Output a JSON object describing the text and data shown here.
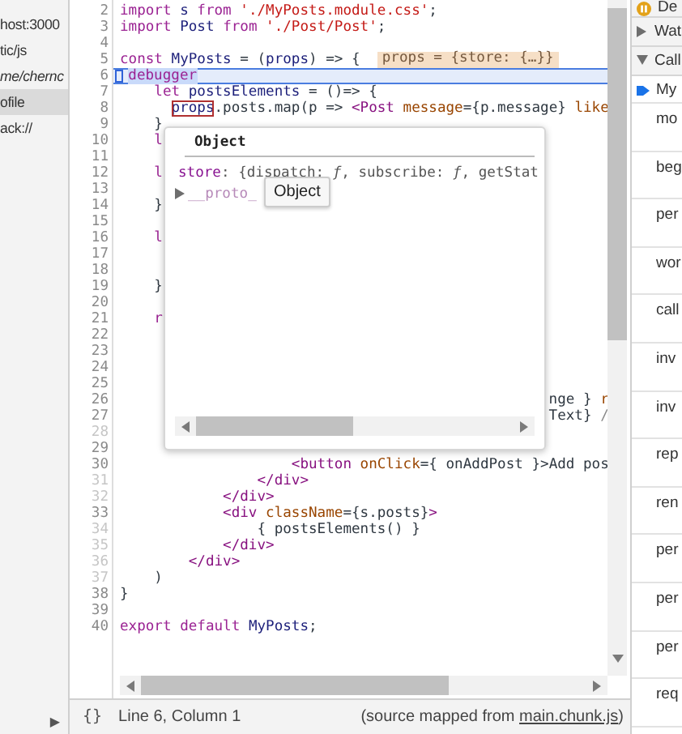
{
  "sidebar": {
    "items": [
      {
        "label": "host:3000",
        "selected": false,
        "italic": false
      },
      {
        "label": "tic/js",
        "selected": false,
        "italic": false
      },
      {
        "label": "me/chernc",
        "selected": false,
        "italic": true
      },
      {
        "label": "ofile",
        "selected": true,
        "italic": false
      },
      {
        "label": "ack://",
        "selected": false,
        "italic": false
      }
    ],
    "toggle": "▶"
  },
  "editor": {
    "lines": [
      {
        "number": "2",
        "breakable": true,
        "current": false,
        "tokens": [
          {
            "kind": "kw",
            "text": "import"
          },
          {
            "kind": "def",
            "text": " s "
          },
          {
            "kind": "kw",
            "text": "from"
          },
          {
            "kind": "str",
            "text": " './MyPosts.module.css'"
          },
          {
            "kind": "plain",
            "text": ";"
          }
        ]
      },
      {
        "number": "3",
        "breakable": true,
        "current": false,
        "tokens": [
          {
            "kind": "kw",
            "text": "import"
          },
          {
            "kind": "def",
            "text": " Post "
          },
          {
            "kind": "kw",
            "text": "from"
          },
          {
            "kind": "str",
            "text": " './Post/Post'"
          },
          {
            "kind": "plain",
            "text": ";"
          }
        ]
      },
      {
        "number": "4",
        "breakable": true,
        "current": false
      },
      {
        "number": "5",
        "breakable": true,
        "current": false,
        "tokens": [
          {
            "kind": "kw",
            "text": "const"
          },
          {
            "kind": "def",
            "text": " MyPosts"
          },
          {
            "kind": "plain",
            "text": " = ("
          },
          {
            "kind": "def",
            "text": "props"
          },
          {
            "kind": "plain",
            "text": ") => {"
          }
        ],
        "inline_value": "props = {store: {…}}"
      },
      {
        "number": "6",
        "breakable": true,
        "current": true,
        "tokens": [
          {
            "kind": "kw",
            "text": "  debugger"
          }
        ]
      },
      {
        "number": "7",
        "breakable": true,
        "current": false,
        "tokens": [
          {
            "kind": "kw",
            "text": "    let"
          },
          {
            "kind": "def",
            "text": " postsElements"
          },
          {
            "kind": "plain",
            "text": " = ()=> {"
          }
        ]
      },
      {
        "number": "8",
        "breakable": true,
        "current": false,
        "tokens": [
          {
            "kind": "hover",
            "text": "      props"
          },
          {
            "kind": "plain",
            "text": ".posts.map(p => "
          },
          {
            "kind": "tag",
            "text": "<Post"
          },
          {
            "kind": "attr",
            "text": " message"
          },
          {
            "kind": "plain",
            "text": "={p.message} "
          },
          {
            "kind": "attr",
            "text": "like"
          }
        ]
      },
      {
        "number": "9",
        "breakable": true,
        "current": false,
        "tokens": [
          {
            "kind": "plain",
            "text": "    }"
          }
        ]
      },
      {
        "number": "10",
        "breakable": true,
        "current": false,
        "tokens": [
          {
            "kind": "kw",
            "text": "    l"
          }
        ]
      },
      {
        "number": "11",
        "breakable": true,
        "current": false
      },
      {
        "number": "12",
        "breakable": true,
        "current": false,
        "tokens": [
          {
            "kind": "kw",
            "text": "    l"
          }
        ]
      },
      {
        "number": "13",
        "breakable": true,
        "current": false
      },
      {
        "number": "14",
        "breakable": true,
        "current": false,
        "tokens": [
          {
            "kind": "plain",
            "text": "    }"
          }
        ]
      },
      {
        "number": "15",
        "breakable": true,
        "current": false
      },
      {
        "number": "16",
        "breakable": true,
        "current": false,
        "tokens": [
          {
            "kind": "kw",
            "text": "    l"
          }
        ]
      },
      {
        "number": "17",
        "breakable": true,
        "current": false
      },
      {
        "number": "18",
        "breakable": true,
        "current": false
      },
      {
        "number": "19",
        "breakable": true,
        "current": false,
        "tokens": [
          {
            "kind": "plain",
            "text": "    }"
          }
        ]
      },
      {
        "number": "20",
        "breakable": true,
        "current": false
      },
      {
        "number": "21",
        "breakable": true,
        "current": false,
        "tokens": [
          {
            "kind": "kw",
            "text": "    r"
          }
        ]
      },
      {
        "number": "22",
        "breakable": true,
        "current": false
      },
      {
        "number": "23",
        "breakable": true,
        "current": false
      },
      {
        "number": "24",
        "breakable": true,
        "current": false
      },
      {
        "number": "25",
        "breakable": true,
        "current": false
      },
      {
        "number": "26",
        "breakable": true,
        "current": false,
        "tokens": [
          {
            "kind": "plain",
            "text": "                                                  nge } "
          },
          {
            "kind": "attr",
            "text": "r"
          }
        ]
      },
      {
        "number": "27",
        "breakable": true,
        "current": false,
        "tokens": [
          {
            "kind": "plain",
            "text": "                                                  Text} "
          },
          {
            "kind": "comment",
            "text": "/"
          }
        ]
      },
      {
        "number": "28",
        "breakable": false,
        "current": false
      },
      {
        "number": "29",
        "breakable": true,
        "current": false
      },
      {
        "number": "30",
        "breakable": true,
        "current": false,
        "tokens": [
          {
            "kind": "tag",
            "text": "                    <button"
          },
          {
            "kind": "attr",
            "text": " onClick"
          },
          {
            "kind": "plain",
            "text": "={ onAddPost }>Add pos"
          }
        ]
      },
      {
        "number": "31",
        "breakable": false,
        "current": false,
        "tokens": [
          {
            "kind": "tag",
            "text": "                </div>"
          }
        ]
      },
      {
        "number": "32",
        "breakable": false,
        "current": false,
        "tokens": [
          {
            "kind": "tag",
            "text": "            </div>"
          }
        ]
      },
      {
        "number": "33",
        "breakable": true,
        "current": false,
        "tokens": [
          {
            "kind": "tag",
            "text": "            <div"
          },
          {
            "kind": "attr",
            "text": " className"
          },
          {
            "kind": "plain",
            "text": "={s.posts}"
          },
          {
            "kind": "tag",
            "text": ">"
          }
        ]
      },
      {
        "number": "34",
        "breakable": false,
        "current": false,
        "tokens": [
          {
            "kind": "plain",
            "text": "                { postsElements() }"
          }
        ]
      },
      {
        "number": "35",
        "breakable": false,
        "current": false,
        "tokens": [
          {
            "kind": "tag",
            "text": "            </div>"
          }
        ]
      },
      {
        "number": "36",
        "breakable": false,
        "current": false,
        "tokens": [
          {
            "kind": "tag",
            "text": "        </div>"
          }
        ]
      },
      {
        "number": "37",
        "breakable": false,
        "current": false,
        "tokens": [
          {
            "kind": "plain",
            "text": "    )"
          }
        ]
      },
      {
        "number": "38",
        "breakable": true,
        "current": false,
        "tokens": [
          {
            "kind": "plain",
            "text": "}"
          }
        ]
      },
      {
        "number": "39",
        "breakable": true,
        "current": false
      },
      {
        "number": "40",
        "breakable": true,
        "current": false,
        "tokens": [
          {
            "kind": "kw",
            "text": "export"
          },
          {
            "kind": "kw",
            "text": " default"
          },
          {
            "kind": "def",
            "text": " MyPosts"
          },
          {
            "kind": "plain",
            "text": ";"
          }
        ]
      }
    ],
    "popover": {
      "title": "Object",
      "properties": [
        {
          "key": "store",
          "value": ": {dispatch: *ƒ*, subscribe: *ƒ*, getStat",
          "kind": "own"
        },
        {
          "key": "__proto_",
          "kind": "proto"
        }
      ],
      "tooltip": "Object"
    }
  },
  "status_bar": {
    "format_button": "{}",
    "position": "Line 6, Column 1",
    "source_prefix": "(source mapped from ",
    "source_link": "main.chunk.js",
    "source_suffix": ")"
  },
  "right_panel": {
    "sections": [
      {
        "label": "De",
        "kind": "status"
      },
      {
        "label": "Wat",
        "kind": "section",
        "expanded": false
      },
      {
        "label": "Call",
        "kind": "section",
        "expanded": true
      }
    ],
    "frames": [
      {
        "name": "My",
        "selected": true
      },
      {
        "name": "mo",
        "selected": false
      },
      {
        "name": "beg",
        "selected": false
      },
      {
        "name": "per",
        "selected": false
      },
      {
        "name": "wor",
        "selected": false
      },
      {
        "name": "call",
        "selected": false
      },
      {
        "name": "inv",
        "selected": false
      },
      {
        "name": "inv",
        "selected": false
      },
      {
        "name": "rep",
        "selected": false
      },
      {
        "name": "ren",
        "selected": false
      },
      {
        "name": "per",
        "selected": false
      },
      {
        "name": "per",
        "selected": false
      },
      {
        "name": "per",
        "selected": false
      },
      {
        "name": "req",
        "selected": false
      }
    ]
  }
}
